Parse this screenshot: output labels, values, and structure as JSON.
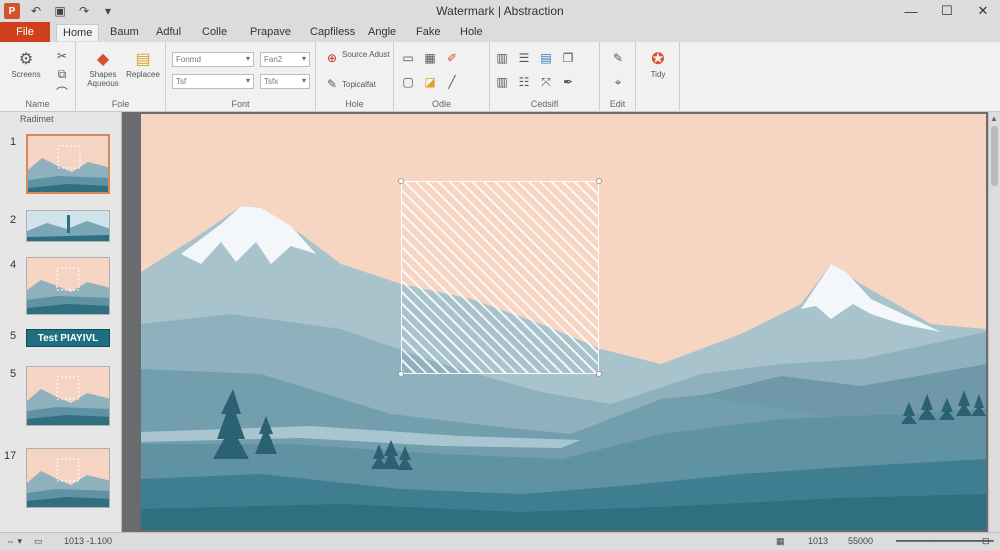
{
  "app": {
    "title": "Watermark | Abstraction"
  },
  "window_controls": {
    "minimize": "—",
    "maximize": "☐",
    "close": "✕"
  },
  "tabs": [
    {
      "label": "File"
    },
    {
      "label": "Home"
    },
    {
      "label": "Baum"
    },
    {
      "label": "Adful"
    },
    {
      "label": "Colle"
    },
    {
      "label": "Prapave"
    },
    {
      "label": "Capfiless"
    },
    {
      "label": "Angle"
    },
    {
      "label": "Fake"
    },
    {
      "label": "Hole"
    }
  ],
  "ribbon": {
    "groups": [
      {
        "label": "Name"
      },
      {
        "label": "Fole"
      },
      {
        "label": "Font"
      },
      {
        "label": "Hole"
      },
      {
        "label": "Odle"
      },
      {
        "label": "Cedsifl"
      },
      {
        "label": "Edit"
      }
    ],
    "buttons": {
      "screens": "Screens",
      "shapes": "Shapes Aqueous",
      "replace": "Replacee",
      "font_name": "Fonmd",
      "font_size": "Fan2",
      "font_b1": "Tsf",
      "font_b2": "Tsfx",
      "source_adjust": "Source Adust",
      "topical": "Topicalfat",
      "tidy": "Tidy"
    }
  },
  "slide_panel": {
    "header": "Radimet",
    "slides": [
      {
        "number": "1",
        "selected": true,
        "kind": "landscape"
      },
      {
        "number": "2",
        "selected": false,
        "kind": "banner"
      },
      {
        "number": "4",
        "selected": false,
        "kind": "landscape"
      },
      {
        "number": "5",
        "selected": false,
        "kind": "text",
        "text": "Test PIAYIVL"
      },
      {
        "number": "5",
        "selected": false,
        "kind": "landscape"
      },
      {
        "number": "17",
        "selected": false,
        "kind": "landscape"
      }
    ]
  },
  "status_bar": {
    "left_text": "1013 -1.100",
    "right_value_1": "1013",
    "right_value_2": "55000"
  },
  "colors": {
    "file_tab": "#d0401f",
    "sky": "#f7d5c3",
    "mountain": "#8fb1bd",
    "valley": "#2f6f80"
  }
}
